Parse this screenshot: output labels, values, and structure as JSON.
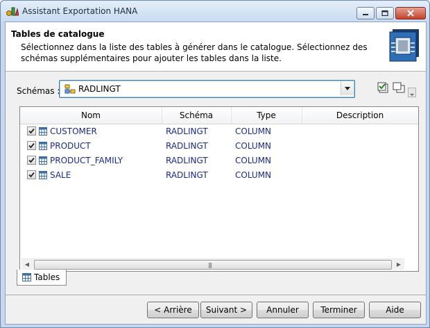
{
  "window": {
    "title": "Assistant Exportation HANA"
  },
  "header": {
    "title": "Tables de catalogue",
    "description": "Sélectionnez dans la liste des tables à générer dans le catalogue. Sélectionnez des schémas supplémentaires pour ajouter les tables dans la liste."
  },
  "schemas": {
    "label": "Schémas :",
    "selected": "RADLINGT"
  },
  "table": {
    "columns": [
      "Nom",
      "Schéma",
      "Type",
      "Description"
    ],
    "rows": [
      {
        "checked": true,
        "name": "CUSTOMER",
        "schema": "RADLINGT",
        "type": "COLUMN",
        "description": ""
      },
      {
        "checked": true,
        "name": "PRODUCT",
        "schema": "RADLINGT",
        "type": "COLUMN",
        "description": ""
      },
      {
        "checked": true,
        "name": "PRODUCT_FAMILY",
        "schema": "RADLINGT",
        "type": "COLUMN",
        "description": ""
      },
      {
        "checked": true,
        "name": "SALE",
        "schema": "RADLINGT",
        "type": "COLUMN",
        "description": ""
      }
    ]
  },
  "tabs": [
    {
      "label": "Tables"
    }
  ],
  "buttons": {
    "back": "< Arrière",
    "next": "Suivant >",
    "cancel": "Annuler",
    "finish": "Terminer",
    "help": "Aide"
  }
}
